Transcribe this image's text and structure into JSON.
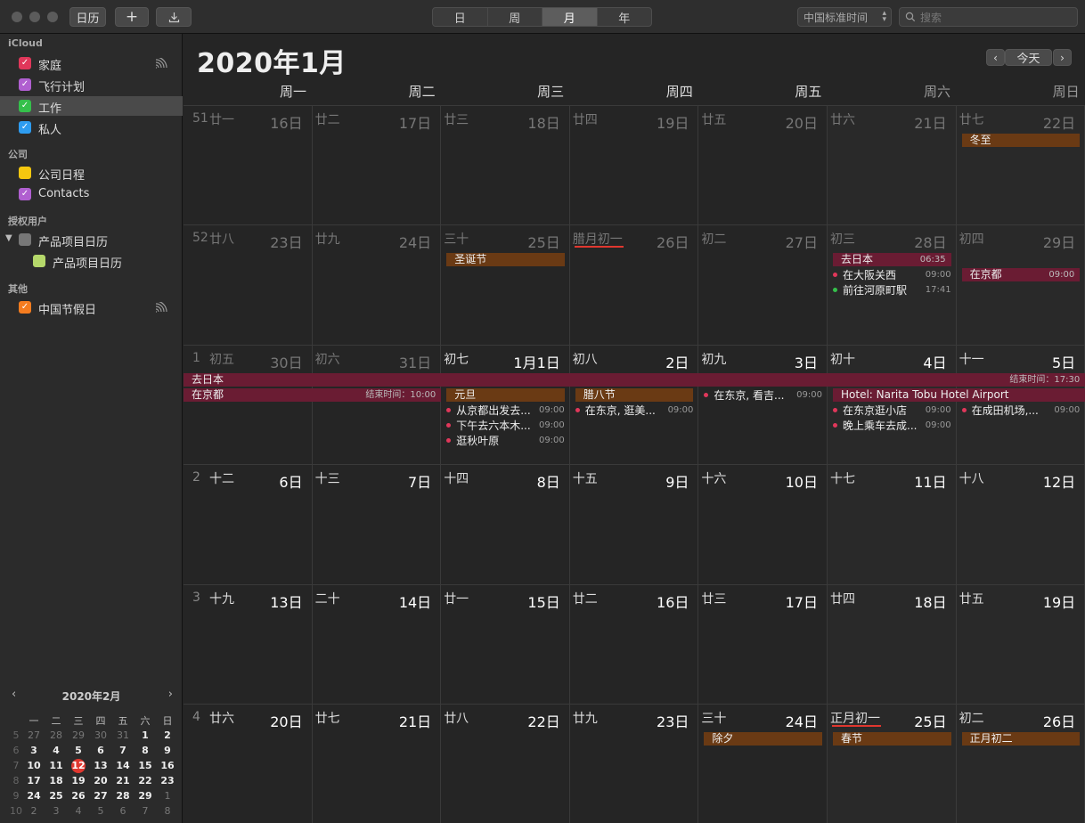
{
  "toolbar": {
    "calendars_btn": "日历",
    "add_btn": "+",
    "import_icon": "download-icon",
    "views": [
      "日",
      "周",
      "月",
      "年"
    ],
    "active_view": "月",
    "timezone": "中国标准时间",
    "search_placeholder": "搜索"
  },
  "sidebar": {
    "groups": [
      {
        "title": "iCloud",
        "items": [
          {
            "label": "家庭",
            "color": "#e0375a",
            "checked": true,
            "shared": true
          },
          {
            "label": "飞行计划",
            "color": "#b05fd0",
            "checked": true
          },
          {
            "label": "工作",
            "color": "#35c04b",
            "checked": true,
            "selected": true
          },
          {
            "label": "私人",
            "color": "#2e9cf0",
            "checked": true
          }
        ]
      },
      {
        "title": "公司",
        "items": [
          {
            "label": "公司日程",
            "color": "#f5c70f",
            "checked": false
          },
          {
            "label": "Contacts",
            "color": "#b05fd0",
            "checked": true
          }
        ]
      },
      {
        "title": "授权用户",
        "items": [
          {
            "label": "产品项目日历",
            "color": "#777777",
            "checked": false,
            "disclosure": "expanded"
          },
          {
            "label": "产品项目日历",
            "color": "#b5d86a",
            "checked": false,
            "child": true
          }
        ]
      },
      {
        "title": "其他",
        "items": [
          {
            "label": "中国节假日",
            "color": "#f57c1f",
            "checked": true,
            "shared": true
          }
        ]
      }
    ],
    "mini_calendar": {
      "title": "2020年2月",
      "weekday_headers": [
        "一",
        "二",
        "三",
        "四",
        "五",
        "六",
        "日"
      ],
      "today": "12",
      "rows": [
        {
          "week": "5",
          "days": [
            "27",
            "28",
            "29",
            "30",
            "31",
            "1",
            "2"
          ],
          "other": [
            true,
            true,
            true,
            true,
            true,
            false,
            false
          ]
        },
        {
          "week": "6",
          "days": [
            "3",
            "4",
            "5",
            "6",
            "7",
            "8",
            "9"
          ],
          "other": [
            false,
            false,
            false,
            false,
            false,
            false,
            false
          ]
        },
        {
          "week": "7",
          "days": [
            "10",
            "11",
            "12",
            "13",
            "14",
            "15",
            "16"
          ],
          "other": [
            false,
            false,
            false,
            false,
            false,
            false,
            false
          ]
        },
        {
          "week": "8",
          "days": [
            "17",
            "18",
            "19",
            "20",
            "21",
            "22",
            "23"
          ],
          "other": [
            false,
            false,
            false,
            false,
            false,
            false,
            false
          ]
        },
        {
          "week": "9",
          "days": [
            "24",
            "25",
            "26",
            "27",
            "28",
            "29",
            "1"
          ],
          "other": [
            false,
            false,
            false,
            false,
            false,
            false,
            true
          ]
        },
        {
          "week": "10",
          "days": [
            "2",
            "3",
            "4",
            "5",
            "6",
            "7",
            "8"
          ],
          "other": [
            true,
            true,
            true,
            true,
            true,
            true,
            true
          ]
        }
      ]
    }
  },
  "main": {
    "title": "2020年1月",
    "today_btn": "今天",
    "prev_icon": "chevron-left-icon",
    "next_icon": "chevron-right-icon",
    "weekdays": [
      "周一",
      "周二",
      "周三",
      "周四",
      "周五",
      "周六",
      "周日"
    ],
    "weeks": [
      {
        "num": "51",
        "days": [
          {
            "lunar": "廿一",
            "day": "16日",
            "dim": true
          },
          {
            "lunar": "廿二",
            "day": "17日",
            "dim": true
          },
          {
            "lunar": "廿三",
            "day": "18日",
            "dim": true
          },
          {
            "lunar": "廿四",
            "day": "19日",
            "dim": true
          },
          {
            "lunar": "廿五",
            "day": "20日",
            "dim": true
          },
          {
            "lunar": "廿六",
            "day": "21日",
            "dim": true
          },
          {
            "lunar": "廿七",
            "day": "22日",
            "dim": true
          }
        ]
      },
      {
        "num": "52",
        "days": [
          {
            "lunar": "廿八",
            "day": "23日",
            "dim": true
          },
          {
            "lunar": "廿九",
            "day": "24日",
            "dim": true
          },
          {
            "lunar": "三十",
            "day": "25日",
            "dim": true
          },
          {
            "lunar": "腊月初一",
            "day": "26日",
            "dim": true,
            "underline": true
          },
          {
            "lunar": "初二",
            "day": "27日",
            "dim": true
          },
          {
            "lunar": "初三",
            "day": "28日",
            "dim": true
          },
          {
            "lunar": "初四",
            "day": "29日",
            "dim": true
          }
        ]
      },
      {
        "num": "1",
        "days": [
          {
            "lunar": "初五",
            "day": "30日",
            "dim": true
          },
          {
            "lunar": "初六",
            "day": "31日",
            "dim": true
          },
          {
            "lunar": "初七",
            "day": "1月1日",
            "dim": false
          },
          {
            "lunar": "初八",
            "day": "2日",
            "dim": false
          },
          {
            "lunar": "初九",
            "day": "3日",
            "dim": false
          },
          {
            "lunar": "初十",
            "day": "4日",
            "dim": false
          },
          {
            "lunar": "十一",
            "day": "5日",
            "dim": false
          }
        ]
      },
      {
        "num": "2",
        "days": [
          {
            "lunar": "十二",
            "day": "6日",
            "dim": false
          },
          {
            "lunar": "十三",
            "day": "7日",
            "dim": false
          },
          {
            "lunar": "十四",
            "day": "8日",
            "dim": false
          },
          {
            "lunar": "十五",
            "day": "9日",
            "dim": false
          },
          {
            "lunar": "十六",
            "day": "10日",
            "dim": false
          },
          {
            "lunar": "十七",
            "day": "11日",
            "dim": false
          },
          {
            "lunar": "十八",
            "day": "12日",
            "dim": false
          }
        ]
      },
      {
        "num": "3",
        "days": [
          {
            "lunar": "十九",
            "day": "13日",
            "dim": false
          },
          {
            "lunar": "二十",
            "day": "14日",
            "dim": false
          },
          {
            "lunar": "廿一",
            "day": "15日",
            "dim": false
          },
          {
            "lunar": "廿二",
            "day": "16日",
            "dim": false
          },
          {
            "lunar": "廿三",
            "day": "17日",
            "dim": false
          },
          {
            "lunar": "廿四",
            "day": "18日",
            "dim": false
          },
          {
            "lunar": "廿五",
            "day": "19日",
            "dim": false
          }
        ]
      },
      {
        "num": "4",
        "days": [
          {
            "lunar": "廿六",
            "day": "20日",
            "dim": false
          },
          {
            "lunar": "廿七",
            "day": "21日",
            "dim": false
          },
          {
            "lunar": "廿八",
            "day": "22日",
            "dim": false
          },
          {
            "lunar": "廿九",
            "day": "23日",
            "dim": false
          },
          {
            "lunar": "三十",
            "day": "24日",
            "dim": false
          },
          {
            "lunar": "正月初一",
            "day": "25日",
            "dim": false,
            "underline": true
          },
          {
            "lunar": "初二",
            "day": "26日",
            "dim": false
          }
        ]
      }
    ],
    "events": [
      {
        "type": "bar",
        "week": 0,
        "col": 6,
        "span": 1,
        "slot": 0,
        "label": "冬至",
        "style": "brown"
      },
      {
        "type": "bar",
        "week": 1,
        "col": 2,
        "span": 1,
        "slot": 0,
        "label": "圣诞节",
        "style": "brown"
      },
      {
        "type": "bar",
        "week": 1,
        "col": 5,
        "span": 1,
        "slot": 0,
        "label": "去日本",
        "time": "06:35",
        "style": "red"
      },
      {
        "type": "dot",
        "week": 1,
        "col": 5,
        "slot": 1,
        "label": "在大阪关西",
        "time": "09:00",
        "dot": "#e0375a"
      },
      {
        "type": "dot",
        "week": 1,
        "col": 5,
        "slot": 2,
        "label": "前往河原町駅",
        "time": "17:41",
        "dot": "#35c04b"
      },
      {
        "type": "bar",
        "week": 1,
        "col": 6,
        "span": 1,
        "slot": 1,
        "label": "在京都",
        "time": "09:00",
        "style": "red"
      },
      {
        "type": "bar",
        "week": 2,
        "col": 0,
        "span": 7,
        "slot": 0,
        "label": "去日本",
        "time": "结束时间：17:30",
        "style": "red"
      },
      {
        "type": "bar",
        "week": 2,
        "col": 0,
        "span": 2,
        "slot": 1,
        "label": "在京都",
        "time": "结束时间：10:00",
        "style": "red"
      },
      {
        "type": "bar",
        "week": 2,
        "col": 2,
        "span": 1,
        "slot": 1,
        "label": "元旦",
        "style": "brown"
      },
      {
        "type": "dot",
        "week": 2,
        "col": 2,
        "slot": 2,
        "label": "从京都出发去...",
        "time": "09:00",
        "dot": "#e0375a"
      },
      {
        "type": "dot",
        "week": 2,
        "col": 2,
        "slot": 3,
        "label": "下午去六本木...",
        "time": "09:00",
        "dot": "#e0375a"
      },
      {
        "type": "dot",
        "week": 2,
        "col": 2,
        "slot": 4,
        "label": "逛秋叶原",
        "time": "09:00",
        "dot": "#e0375a"
      },
      {
        "type": "bar",
        "week": 2,
        "col": 3,
        "span": 1,
        "slot": 1,
        "label": "腊八节",
        "style": "brown"
      },
      {
        "type": "dot",
        "week": 2,
        "col": 3,
        "slot": 2,
        "label": "在东京, 逛美...",
        "time": "09:00",
        "dot": "#e0375a"
      },
      {
        "type": "dot",
        "week": 2,
        "col": 4,
        "slot": 1,
        "label": "在东京, 看吉...",
        "time": "09:00",
        "dot": "#e0375a"
      },
      {
        "type": "bar",
        "week": 2,
        "col": 5,
        "span": 2,
        "slot": 1,
        "label": "Hotel: Narita Tobu Hotel Airport",
        "style": "red"
      },
      {
        "type": "dot",
        "week": 2,
        "col": 5,
        "slot": 2,
        "label": "在东京逛小店",
        "time": "09:00",
        "dot": "#e0375a"
      },
      {
        "type": "dot",
        "week": 2,
        "col": 5,
        "slot": 3,
        "label": "晚上乘车去成...",
        "time": "09:00",
        "dot": "#e0375a"
      },
      {
        "type": "dot",
        "week": 2,
        "col": 6,
        "slot": 2,
        "label": "在成田机场,...",
        "time": "09:00",
        "dot": "#e0375a"
      },
      {
        "type": "bar",
        "week": 5,
        "col": 4,
        "span": 1,
        "slot": 0,
        "label": "除夕",
        "style": "brown"
      },
      {
        "type": "bar",
        "week": 5,
        "col": 5,
        "span": 1,
        "slot": 0,
        "label": "春节",
        "style": "brown"
      },
      {
        "type": "bar",
        "week": 5,
        "col": 6,
        "span": 1,
        "slot": 0,
        "label": "正月初二",
        "style": "brown"
      }
    ]
  }
}
